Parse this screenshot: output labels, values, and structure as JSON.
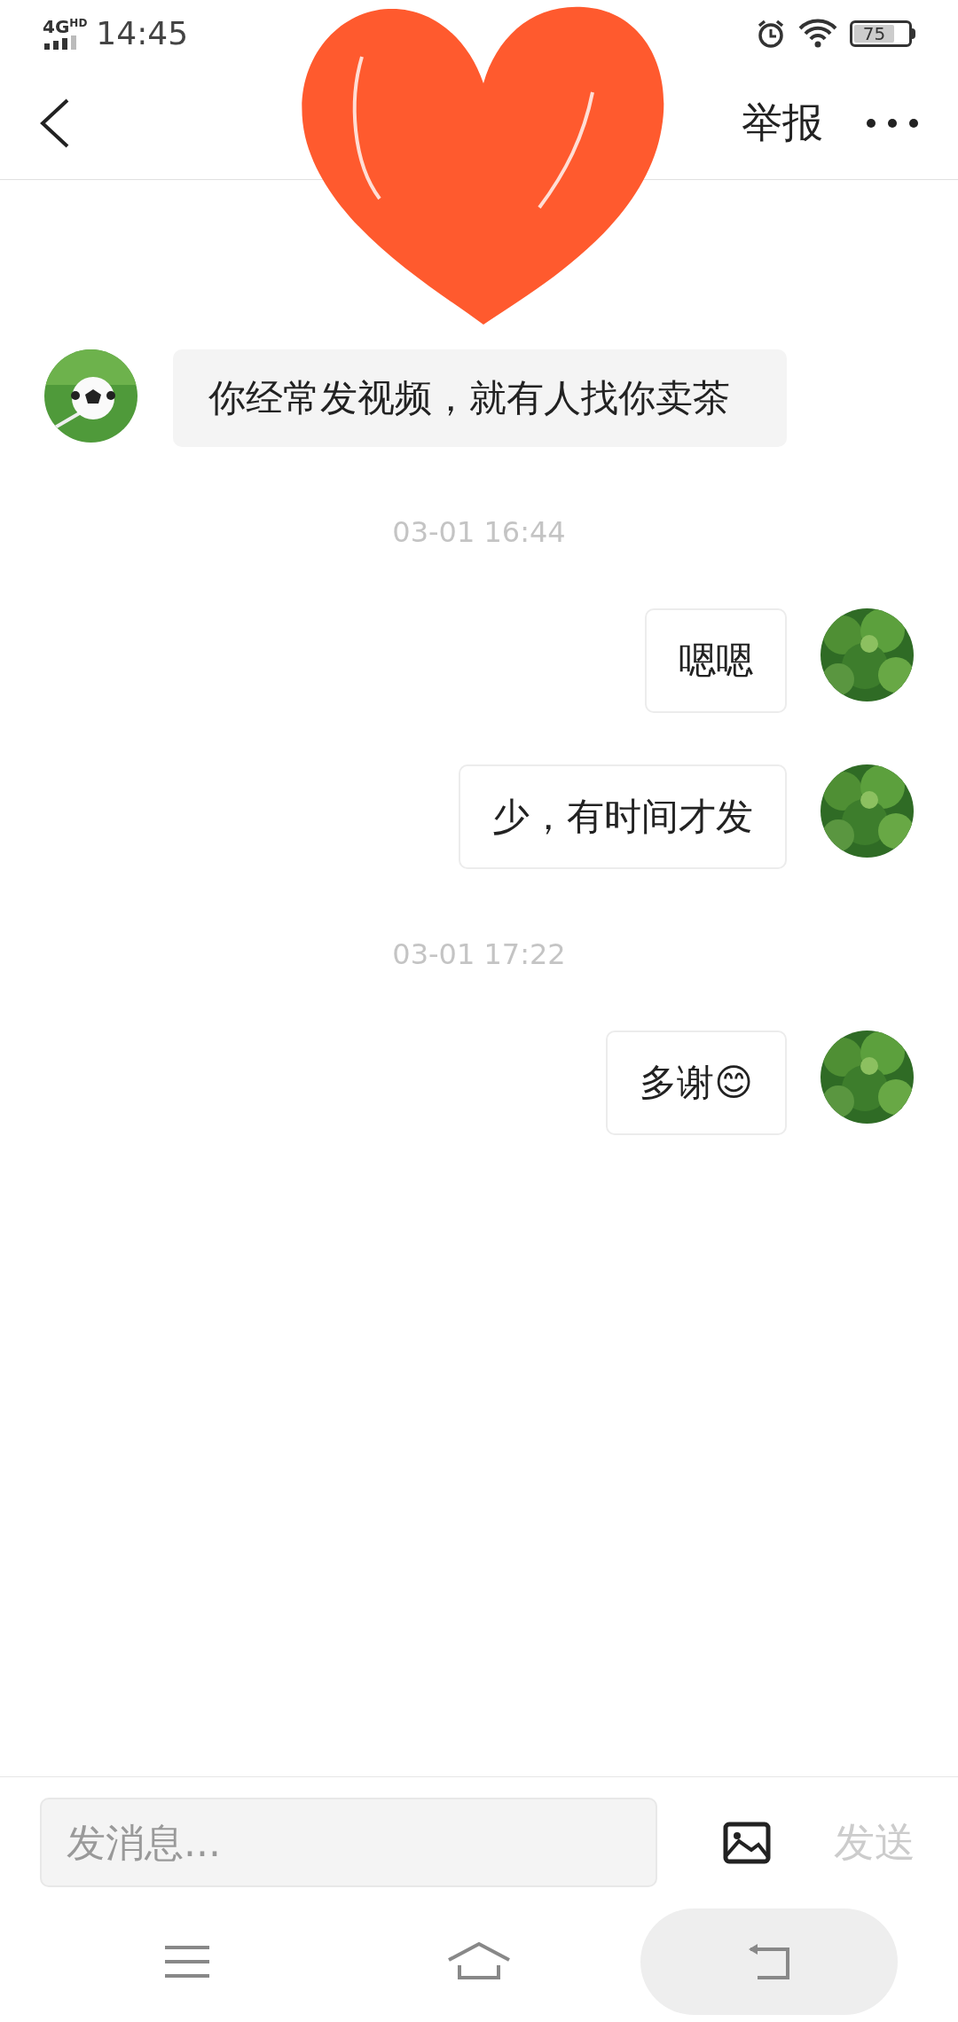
{
  "status_bar": {
    "network": "4G",
    "network_sub": "HD",
    "time": "14:45",
    "battery": "75"
  },
  "header": {
    "report": "举报"
  },
  "messages": [
    {
      "kind": "incoming",
      "text": "你经常发视频，就有人找你卖茶"
    },
    {
      "kind": "time",
      "text": "03-01 16:44"
    },
    {
      "kind": "outgoing",
      "text": "嗯嗯"
    },
    {
      "kind": "outgoing",
      "text": "少，有时间才发"
    },
    {
      "kind": "time",
      "text": "03-01 17:22"
    },
    {
      "kind": "outgoing",
      "text": "多谢😊"
    }
  ],
  "composer": {
    "placeholder": "发消息...",
    "send": "发送",
    "send_disabled": true
  }
}
